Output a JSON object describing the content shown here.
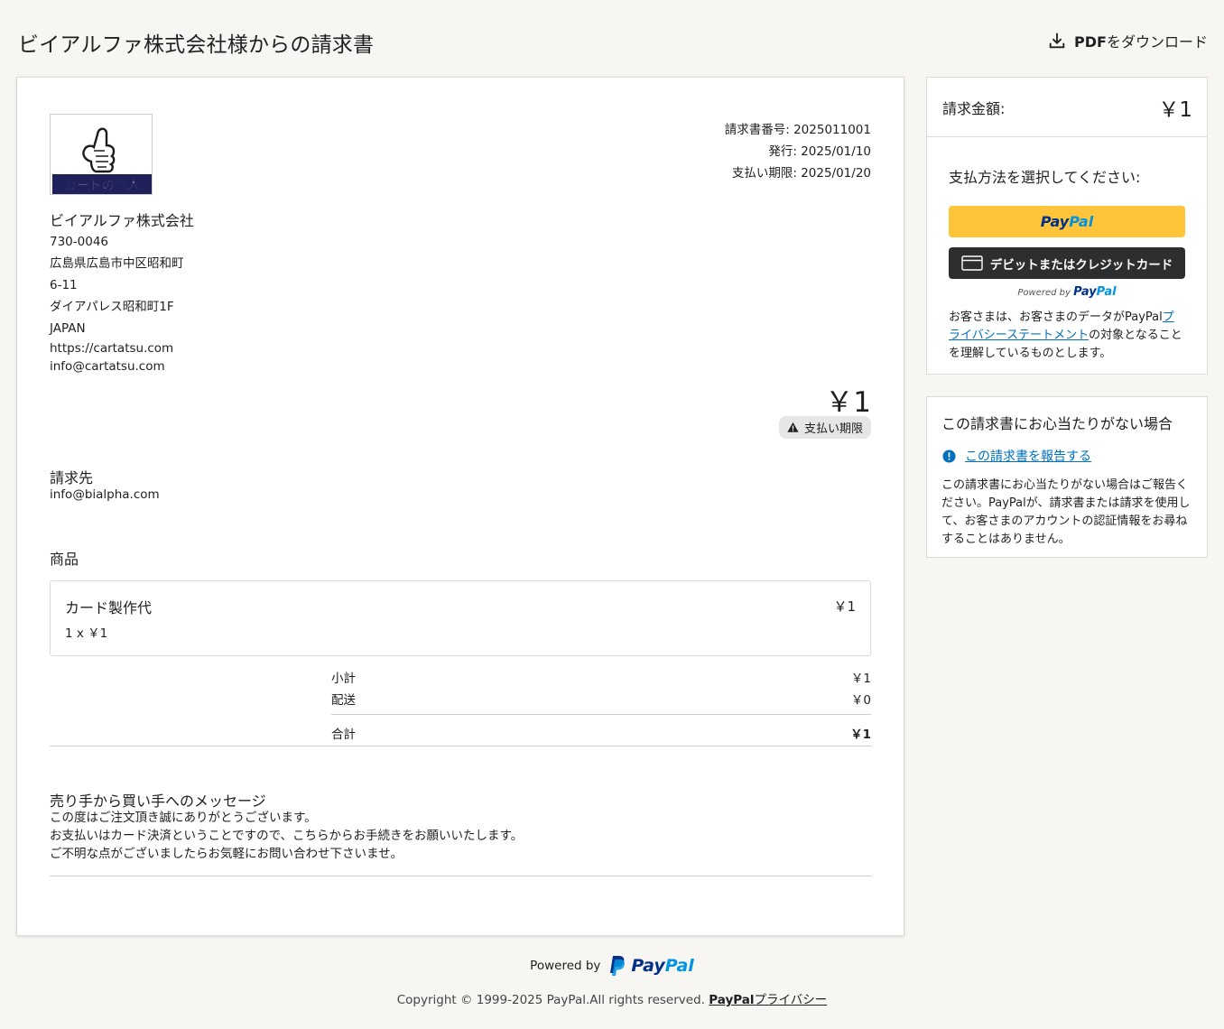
{
  "header": {
    "title": "ビイアルファ株式会社様からの請求書",
    "pdf_bold": "PDF",
    "pdf_rest": "をダウンロード"
  },
  "logo": {
    "text": "カードの達人"
  },
  "invoice_meta": {
    "number_label": "請求書番号:",
    "number_value": "2025011001",
    "issued_label": "発行:",
    "issued_value": "2025/01/10",
    "due_label": "支払い期限:",
    "due_value": "2025/01/20"
  },
  "seller": {
    "name": "ビイアルファ株式会社",
    "postal": "730-0046",
    "address1": "広島県広島市中区昭和町",
    "address2": "6-11",
    "address3": "ダイアパレス昭和町1F",
    "country": "JAPAN",
    "website": "https://cartatsu.com",
    "email": "info@cartatsu.com"
  },
  "amount": {
    "value": "￥1",
    "badge": "支払い期限"
  },
  "bill_to": {
    "label": "請求先",
    "email": "info@bialpha.com"
  },
  "items": {
    "label": "商品",
    "list": [
      {
        "name": "カード製作代",
        "price": "￥1",
        "qty_line": "1 x ￥1"
      }
    ]
  },
  "totals": {
    "subtotal_label": "小計",
    "subtotal_value": "￥1",
    "shipping_label": "配送",
    "shipping_value": "￥0",
    "total_label": "合計",
    "total_value": "￥1"
  },
  "message": {
    "label": "売り手から買い手へのメッセージ",
    "line1": "この度はご注文頂き誠にありがとうございます。",
    "line2": "お支払いはカード決済ということですので、こちらからお手続きをお願いいたします。",
    "line3": "ご不明な点がございましたらお気軽にお問い合わせ下さいませ。"
  },
  "payment_panel": {
    "amount_label": "請求金額:",
    "amount_value": "￥1",
    "choose_label": "支払方法を選択してください:",
    "paypal_btn_part1": "Pay",
    "paypal_btn_part2": "Pal",
    "card_btn": "デビットまたはクレジットカード",
    "powered_by": "Powered by",
    "powered_pp1": "Pay",
    "powered_pp2": "Pal",
    "privacy_pre": "お客さまは、お客さまのデータがPayPal",
    "privacy_link": "プライバシーステートメント",
    "privacy_post": "の対象となることを理解しているものとします。"
  },
  "report_panel": {
    "title": "この請求書にお心当たりがない場合",
    "link": "この請求書を報告する",
    "body": "この請求書にお心当たりがない場合はご報告ください。PayPalが、請求書または請求を使用して、お客さまのアカウントの認証情報をお尋ねすることはありません。"
  },
  "footer": {
    "powered_by": "Powered by",
    "pp1": "Pay",
    "pp2": "Pal",
    "copyright": "Copyright © 1999-2025 PayPal.All rights reserved.",
    "privacy_bold": "PayPal",
    "privacy_rest": "プライバシー"
  },
  "colors": {
    "paypal_yellow": "#ffc43a",
    "paypal_dark_blue": "#003087",
    "paypal_light_blue": "#0094e0",
    "link_blue": "#0070ba",
    "card_button": "#2c2e2f",
    "background": "#f7f6f3"
  },
  "icons": [
    "download-icon",
    "warning-icon",
    "card-icon",
    "info-icon",
    "paypal-p-icon"
  ]
}
